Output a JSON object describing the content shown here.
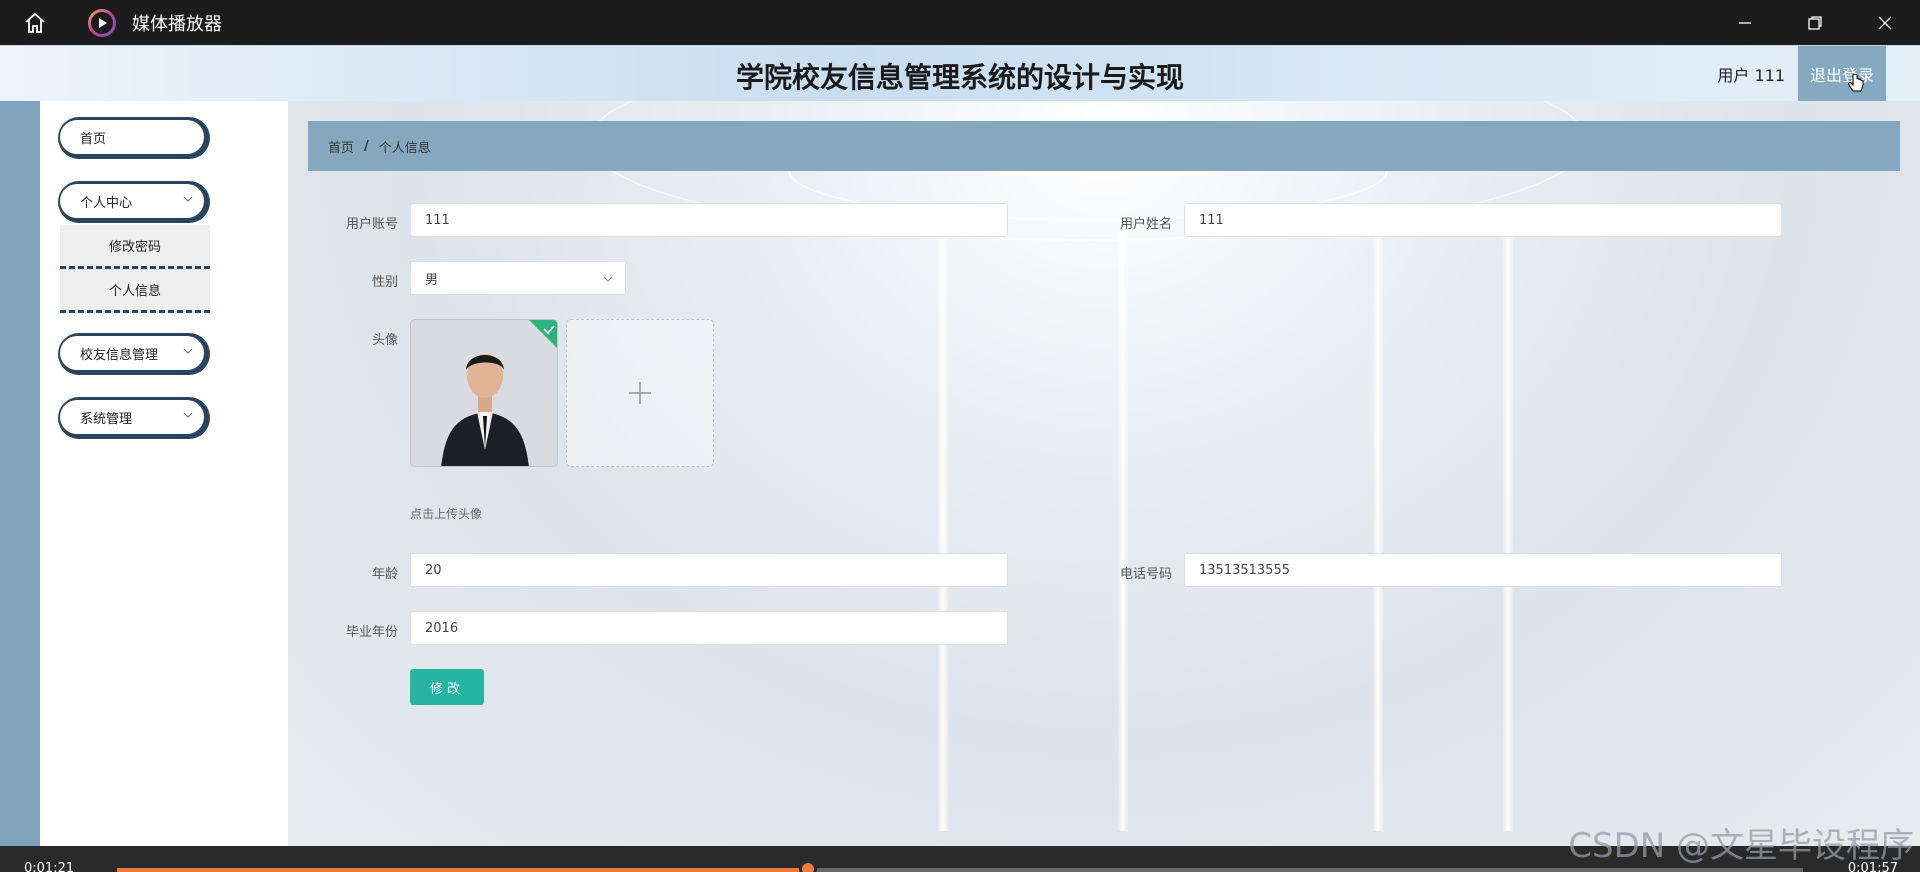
{
  "player": {
    "app_title": "媒体播放器",
    "time_current": "0:01:21",
    "time_total": "0:01:57",
    "progress": 0.41,
    "accent_color": "#f07a3a"
  },
  "header": {
    "title": "学院校友信息管理系统的设计与实现",
    "user_label": "用户 111",
    "logout_label": "退出登录"
  },
  "sidebar": {
    "items": [
      {
        "label": "首页",
        "icon": "none"
      },
      {
        "label": "个人中心",
        "icon": "chevron-down-icon"
      },
      {
        "label": "修改密码",
        "icon": "none"
      },
      {
        "label": "个人信息",
        "icon": "none"
      },
      {
        "label": "校友信息管理",
        "icon": "chevron-down-icon"
      },
      {
        "label": "系统管理",
        "icon": "chevron-down-icon"
      }
    ]
  },
  "breadcrumb": {
    "home": "首页",
    "separator": "/",
    "current": "个人信息"
  },
  "form": {
    "account_label": "用户账号",
    "account_value": "111",
    "name_label": "用户姓名",
    "name_value": "111",
    "gender_label": "性别",
    "gender_value": "男",
    "avatar_label": "头像",
    "upload_hint": "点击上传头像",
    "age_label": "年龄",
    "age_value": "20",
    "phone_label": "电话号码",
    "phone_value": "13513513555",
    "grad_year_label": "毕业年份",
    "grad_year_value": "2016",
    "submit_label": "修改"
  },
  "colors": {
    "sidebar_accent": "#27455f",
    "breadcrumb_bg": "#86a8bf",
    "submit_bg": "#26b5a3",
    "logout_bg": "#86a9c2"
  },
  "watermark": "CSDN @文星毕设程序"
}
